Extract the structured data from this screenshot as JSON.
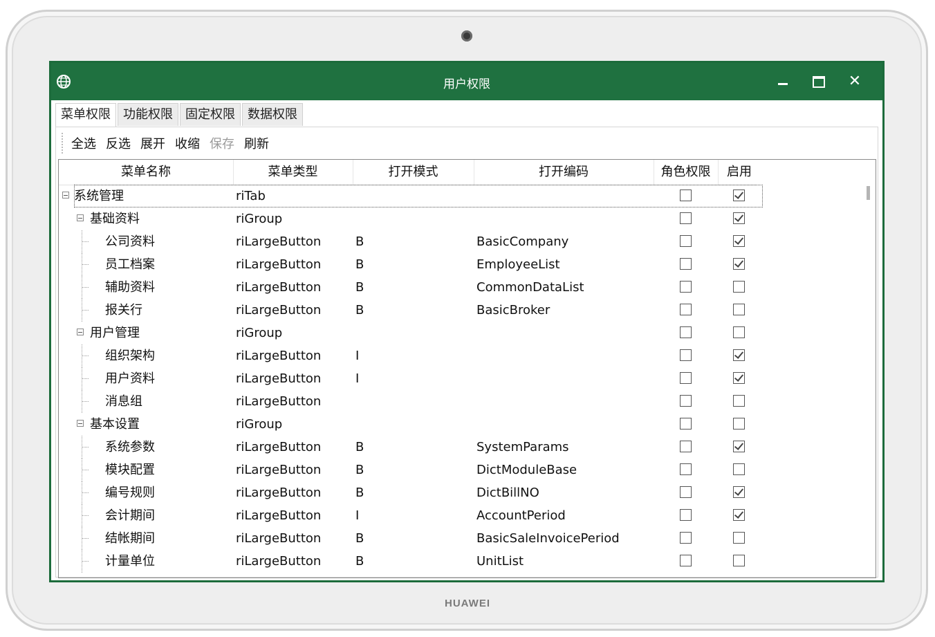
{
  "device": {
    "brand": "HUAWEI"
  },
  "window": {
    "title": "用户权限",
    "controls": {
      "minimize": "minimize",
      "maximize": "maximize",
      "close": "✕"
    }
  },
  "tabs": [
    {
      "label": "菜单权限",
      "active": true
    },
    {
      "label": "功能权限",
      "active": false
    },
    {
      "label": "固定权限",
      "active": false
    },
    {
      "label": "数据权限",
      "active": false
    }
  ],
  "toolbar": {
    "select_all": "全选",
    "invert": "反选",
    "expand": "展开",
    "collapse": "收缩",
    "save": "保存",
    "refresh": "刷新"
  },
  "grid": {
    "columns": {
      "name": "菜单名称",
      "type": "菜单类型",
      "mode": "打开模式",
      "code": "打开编码",
      "role": "角色权限",
      "enable": "启用"
    },
    "rows": [
      {
        "level": 0,
        "name": "系统管理",
        "type": "riTab",
        "mode": "",
        "code": "",
        "role": false,
        "enable": true,
        "selected": true
      },
      {
        "level": 1,
        "name": "基础资料",
        "type": "riGroup",
        "mode": "",
        "code": "",
        "role": false,
        "enable": true
      },
      {
        "level": 2,
        "name": "公司资料",
        "type": "riLargeButton",
        "mode": "B",
        "code": "BasicCompany",
        "role": false,
        "enable": true
      },
      {
        "level": 2,
        "name": "员工档案",
        "type": "riLargeButton",
        "mode": "B",
        "code": "EmployeeList",
        "role": false,
        "enable": true
      },
      {
        "level": 2,
        "name": "辅助资料",
        "type": "riLargeButton",
        "mode": "B",
        "code": "CommonDataList",
        "role": false,
        "enable": false
      },
      {
        "level": 2,
        "name": "报关行",
        "type": "riLargeButton",
        "mode": "B",
        "code": "BasicBroker",
        "role": false,
        "enable": false
      },
      {
        "level": 1,
        "name": "用户管理",
        "type": "riGroup",
        "mode": "",
        "code": "",
        "role": false,
        "enable": false
      },
      {
        "level": 2,
        "name": "组织架构",
        "type": "riLargeButton",
        "mode": "I",
        "code": "",
        "role": false,
        "enable": true
      },
      {
        "level": 2,
        "name": "用户资料",
        "type": "riLargeButton",
        "mode": "I",
        "code": "",
        "role": false,
        "enable": true
      },
      {
        "level": 2,
        "name": "消息组",
        "type": "riLargeButton",
        "mode": "",
        "code": "",
        "role": false,
        "enable": false
      },
      {
        "level": 1,
        "name": "基本设置",
        "type": "riGroup",
        "mode": "",
        "code": "",
        "role": false,
        "enable": false
      },
      {
        "level": 2,
        "name": "系统参数",
        "type": "riLargeButton",
        "mode": "B",
        "code": "SystemParams",
        "role": false,
        "enable": true
      },
      {
        "level": 2,
        "name": "模块配置",
        "type": "riLargeButton",
        "mode": "B",
        "code": "DictModuleBase",
        "role": false,
        "enable": false
      },
      {
        "level": 2,
        "name": "编号规则",
        "type": "riLargeButton",
        "mode": "B",
        "code": "DictBillNO",
        "role": false,
        "enable": true
      },
      {
        "level": 2,
        "name": "会计期间",
        "type": "riLargeButton",
        "mode": "I",
        "code": "AccountPeriod",
        "role": false,
        "enable": true
      },
      {
        "level": 2,
        "name": "结帐期间",
        "type": "riLargeButton",
        "mode": "B",
        "code": "BasicSaleInvoicePeriod",
        "role": false,
        "enable": false
      },
      {
        "level": 2,
        "name": "计量单位",
        "type": "riLargeButton",
        "mode": "B",
        "code": "UnitList",
        "role": false,
        "enable": false
      }
    ]
  },
  "colors": {
    "titlebar": "#1f7140",
    "frame": "#1c6b3b"
  }
}
